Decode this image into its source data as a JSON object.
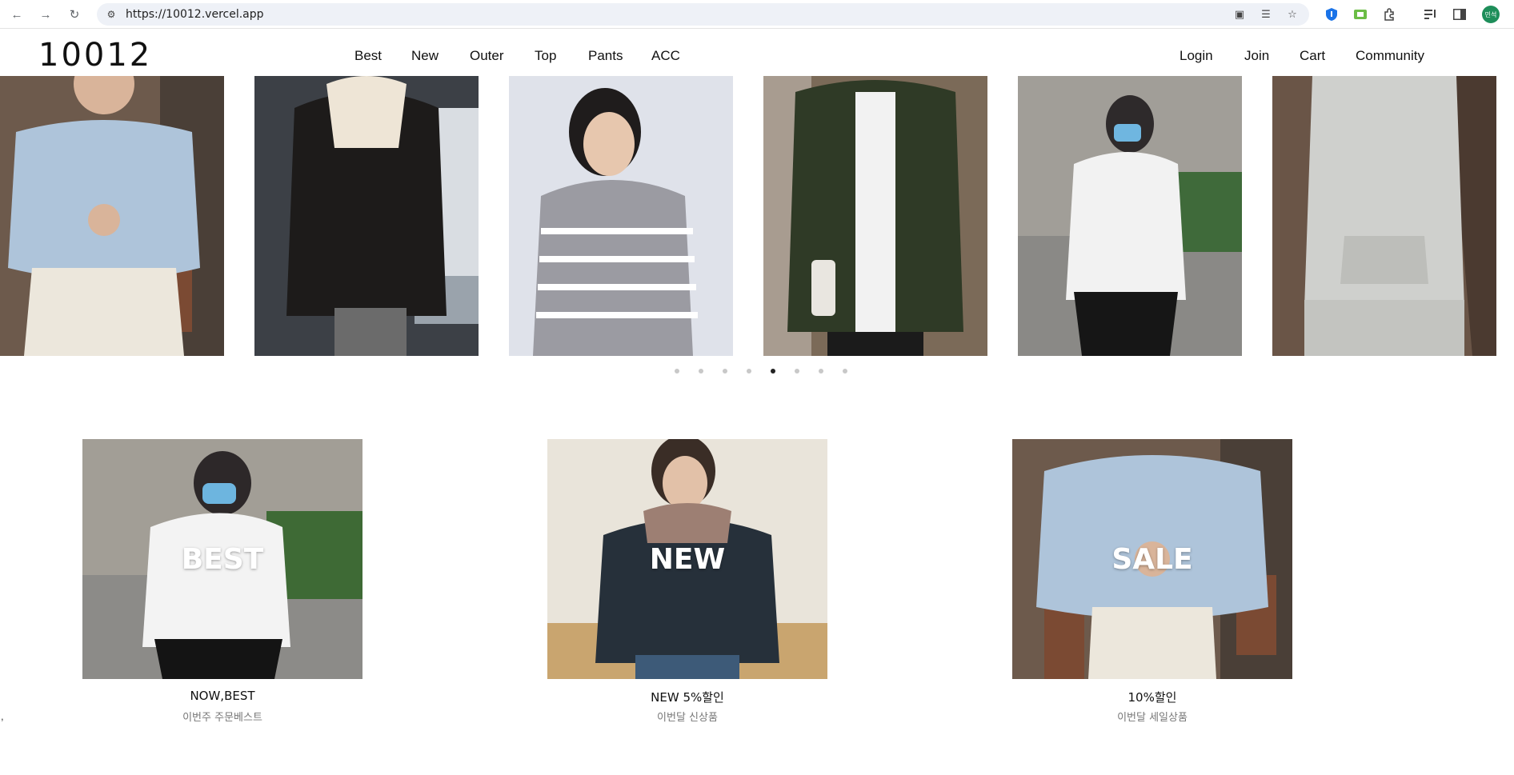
{
  "browser": {
    "url": "https://10012.vercel.app",
    "avatar_text": "민석"
  },
  "site": {
    "logo": "10012",
    "nav": [
      "Best",
      "New",
      "Outer",
      "Top",
      "Pants",
      "ACC"
    ],
    "user_nav": [
      "Login",
      "Join",
      "Cart",
      "Community"
    ]
  },
  "carousel": {
    "slides": [
      {
        "alt": "Blue fuzzy knit sweater"
      },
      {
        "alt": "Black shearling jacket"
      },
      {
        "alt": "Grey striped zip cardigan"
      },
      {
        "alt": "Khaki shirt jacket"
      },
      {
        "alt": "White oversized sweatshirt"
      },
      {
        "alt": "Grey hoodie set"
      }
    ],
    "dot_count": 8,
    "active_dot": 5
  },
  "categories": [
    {
      "overlay": "BEST",
      "title": "NOW,BEST",
      "subtitle": "이번주 주문베스트"
    },
    {
      "overlay": "NEW",
      "title": "NEW 5%할인",
      "subtitle": "이번달 신상품"
    },
    {
      "overlay": "SALE",
      "title": "10%할인",
      "subtitle": "이번달 세일상품"
    }
  ],
  "stray_text": ","
}
